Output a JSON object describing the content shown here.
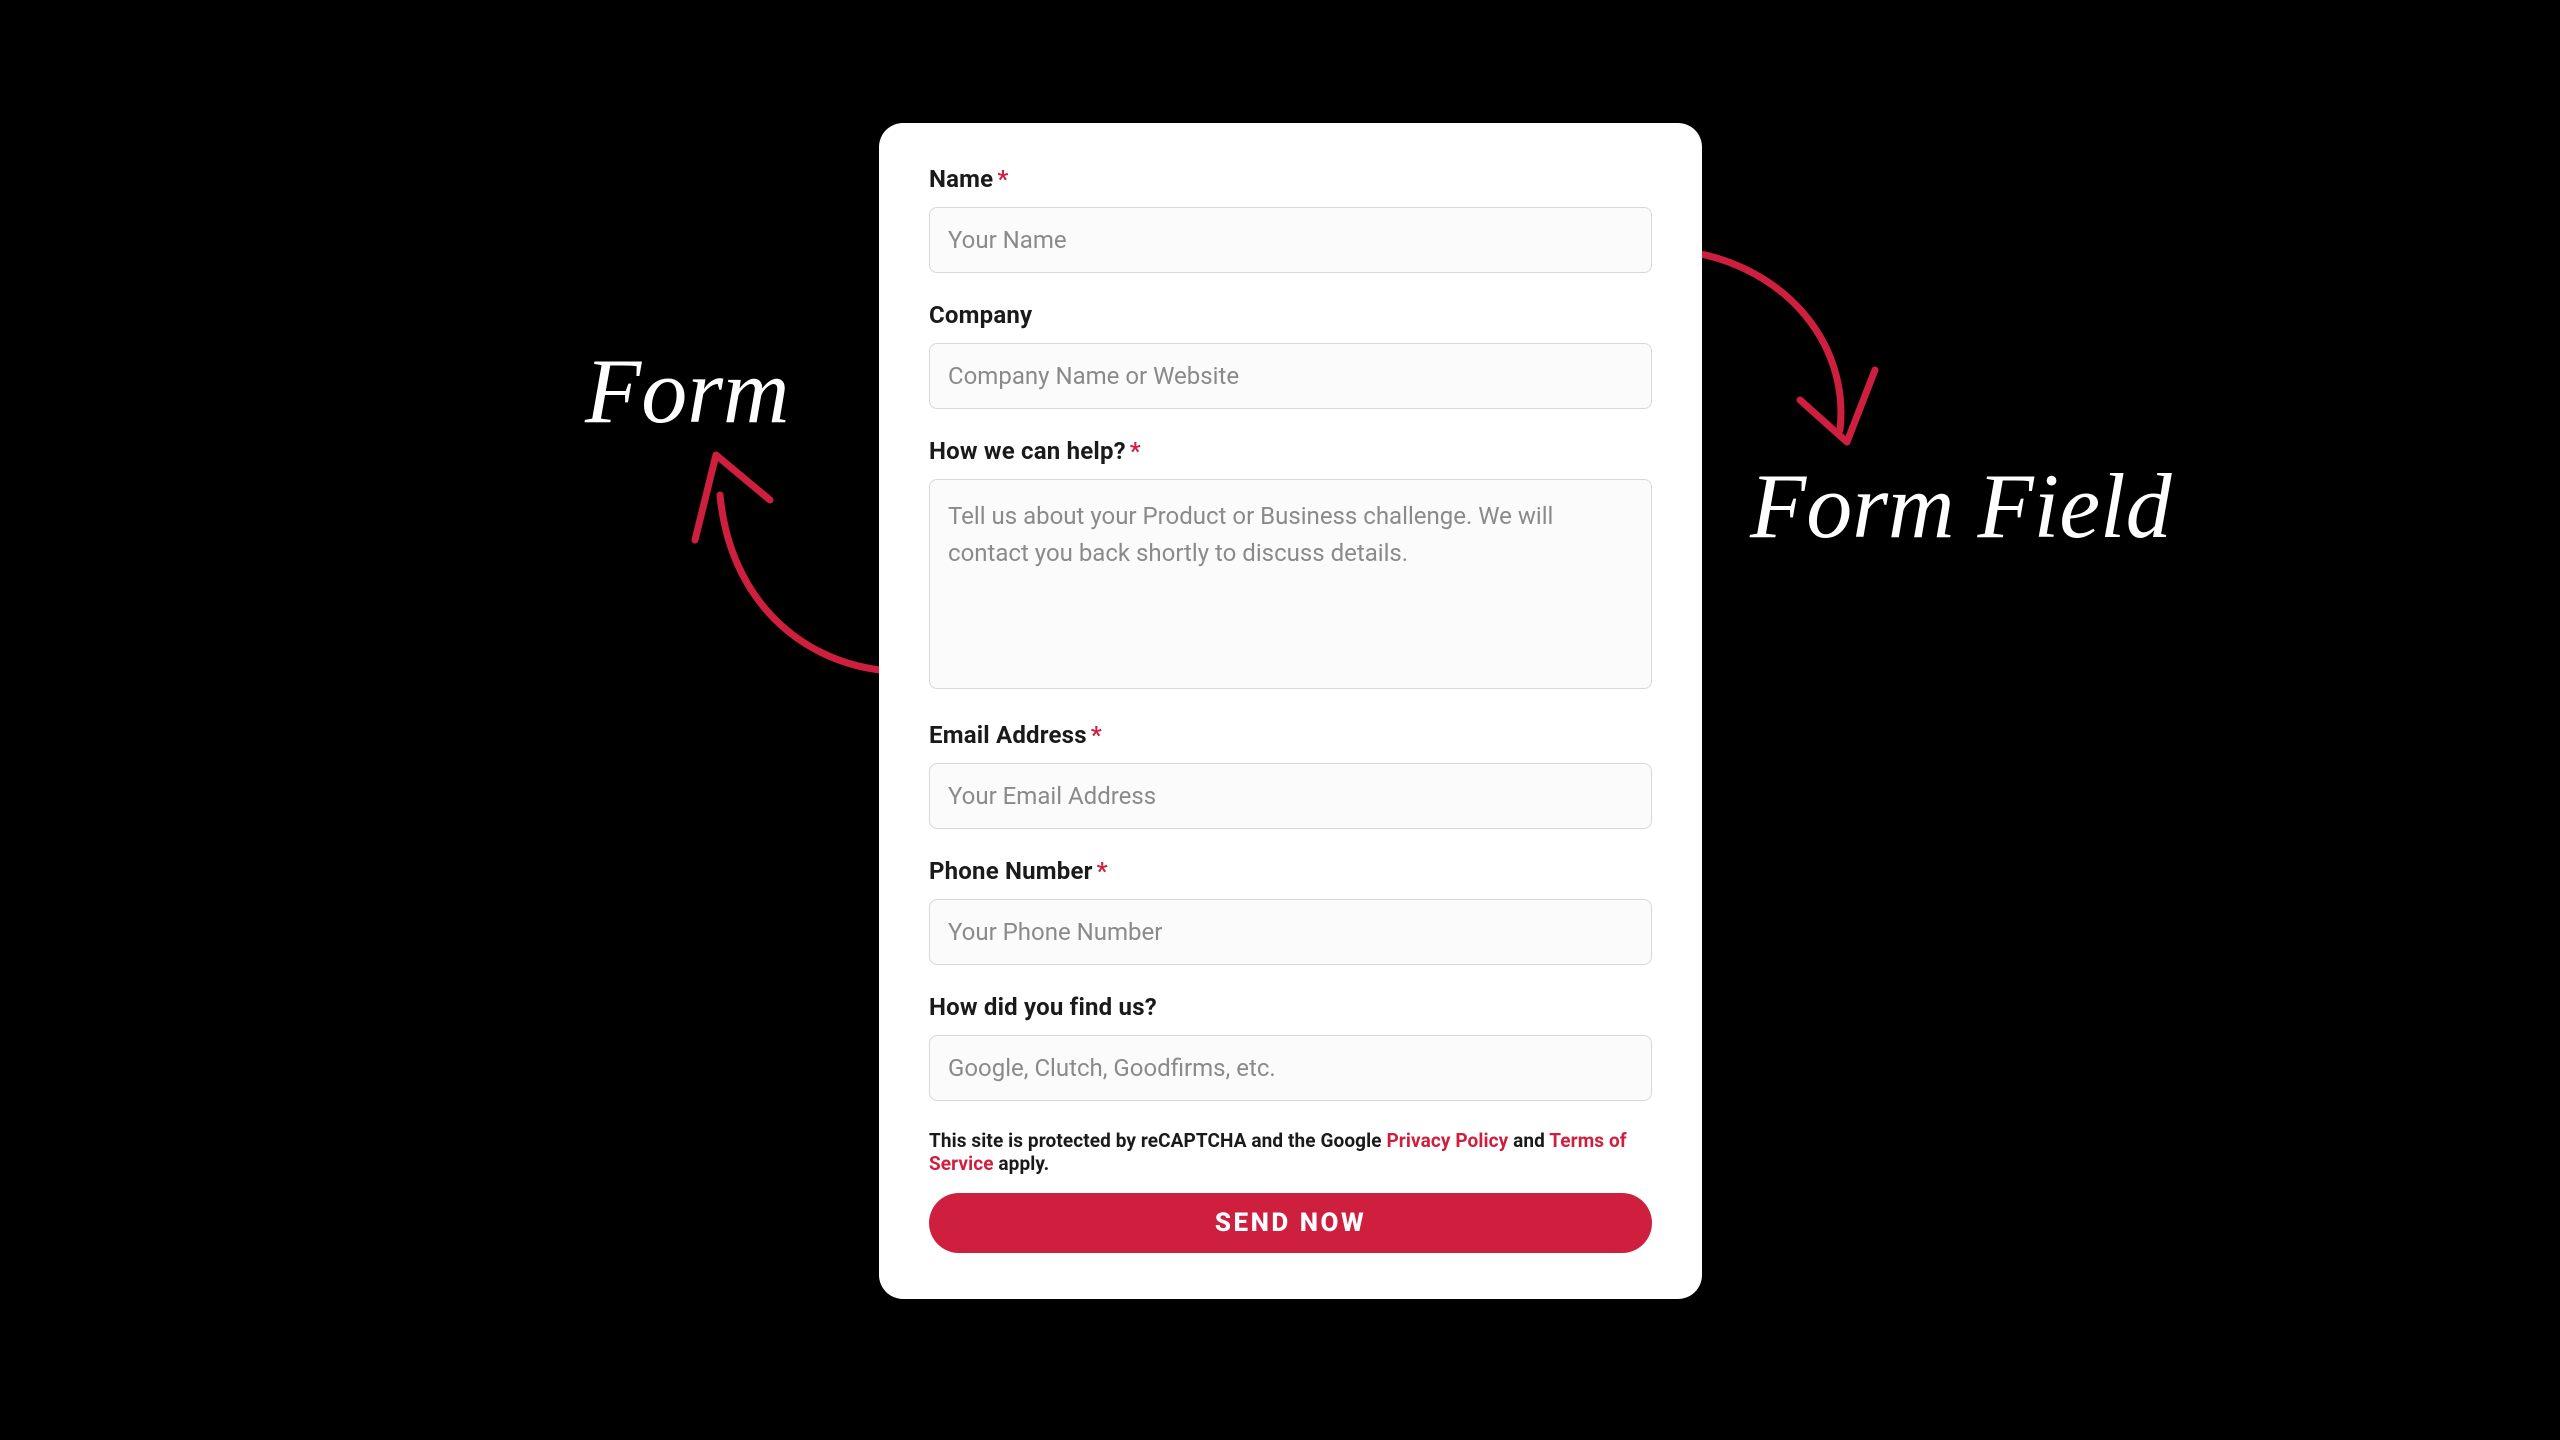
{
  "colors": {
    "accent": "#cf1f3f"
  },
  "annotations": {
    "form_label": "Form",
    "field_label": "Form Field"
  },
  "form": {
    "fields": {
      "name": {
        "label": "Name",
        "required": true,
        "placeholder": "Your Name"
      },
      "company": {
        "label": "Company",
        "required": false,
        "placeholder": "Company Name or Website"
      },
      "help": {
        "label": "How we can help?",
        "required": true,
        "placeholder": "Tell us about your Product or Business challenge. We will contact you back shortly to discuss details."
      },
      "email": {
        "label": "Email Address",
        "required": true,
        "placeholder": "Your Email Address"
      },
      "phone": {
        "label": "Phone Number",
        "required": true,
        "placeholder": "Your Phone Number"
      },
      "findus": {
        "label": "How did you find us?",
        "required": false,
        "placeholder": "Google, Clutch, Goodfirms, etc."
      }
    },
    "disclaimer": {
      "prefix": "This site is protected by reCAPTCHA and the Google ",
      "privacy": "Privacy Policy",
      "and": " and ",
      "terms": "Terms of Service",
      "suffix": " apply."
    },
    "submit_label": "SEND NOW"
  }
}
